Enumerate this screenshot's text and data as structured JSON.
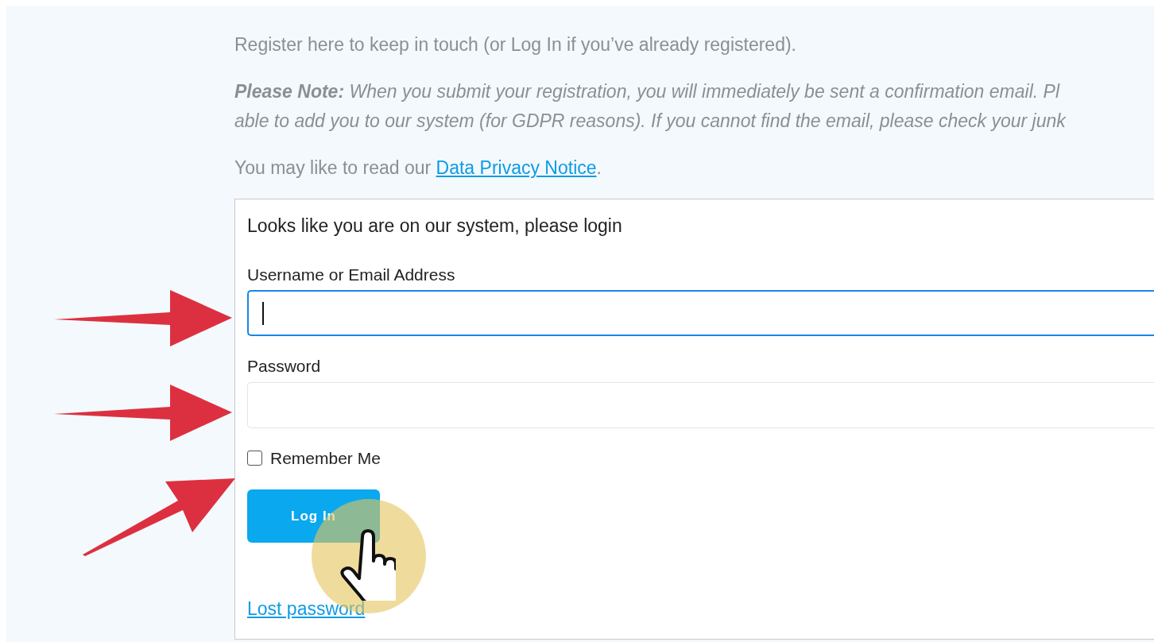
{
  "intro": "Register here to keep in touch (or Log In if you’ve already registered).",
  "note": "**Please Note:** When you submit your registration, you will immediately be sent a confirmation email. Pl\nable to add you to our system (for GDPR reasons). If you cannot find the email, please check your junk",
  "privacy": {
    "text": "You may like to read our ",
    "link": "Data Privacy Notice",
    "after": "."
  },
  "login": {
    "title": "Looks like you are on our system, please login",
    "fields": [
      {
        "label": "Username or Email Address",
        "focused": true
      },
      {
        "label": "Password",
        "focused": false
      }
    ],
    "remember": {
      "label": "Remember Me",
      "checked": false
    },
    "button": "Log In",
    "lost_password": "Lost password"
  }
}
